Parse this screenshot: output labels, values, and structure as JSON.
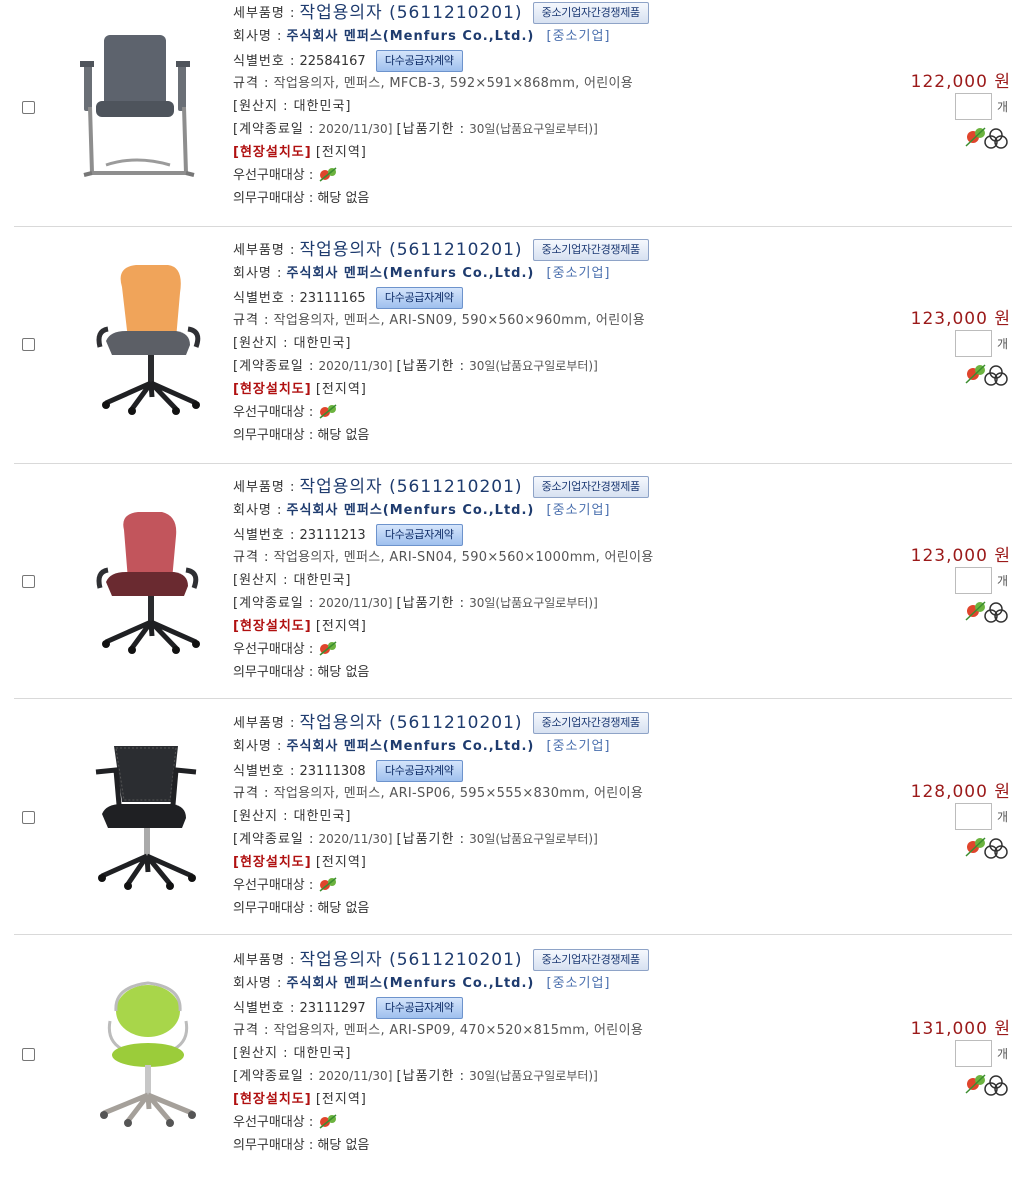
{
  "labels": {
    "detail_name": "세부품명 :",
    "company": "회사명 :",
    "id": "식별번호 :",
    "spec": "규격 :",
    "origin": "[원산지 : 대한민국]",
    "contract_end": "[계약종료일 :",
    "delivery": "[납품기한 :",
    "install": "[현장설치도]",
    "region": "[전지역]",
    "priority": "우선구매대상 :",
    "mandatory": "의무구매대상 :",
    "mandatory_value": "해당 없음",
    "unit": "개",
    "currency": "원"
  },
  "items": [
    {
      "name": "작업용의자 (5611210201)",
      "badge_competition": "중소기업자간경쟁제품",
      "company": "주식회사 멘퍼스(Menfurs Co.,Ltd.)",
      "company_type": "[중소기업]",
      "id": "22584167",
      "badge_contract": "다수공급자계약",
      "spec": "작업용의자, 멘퍼스, MFCB-3, 592×591×868mm, 어린이용",
      "contract_end": "2020/11/30]",
      "delivery": "30일(납품요구일로부터)]",
      "price": "122,000",
      "qty": "",
      "image": "chair-gray-cantilever"
    },
    {
      "name": "작업용의자 (5611210201)",
      "badge_competition": "중소기업자간경쟁제품",
      "company": "주식회사 멘퍼스(Menfurs Co.,Ltd.)",
      "company_type": "[중소기업]",
      "id": "23111165",
      "badge_contract": "다수공급자계약",
      "spec": "작업용의자, 멘퍼스, ARI-SN09, 590×560×960mm, 어린이용",
      "contract_end": "2020/11/30]",
      "delivery": "30일(납품요구일로부터)]",
      "price": "123,000",
      "qty": "",
      "image": "chair-orange-swivel"
    },
    {
      "name": "작업용의자 (5611210201)",
      "badge_competition": "중소기업자간경쟁제품",
      "company": "주식회사 멘퍼스(Menfurs Co.,Ltd.)",
      "company_type": "[중소기업]",
      "id": "23111213",
      "badge_contract": "다수공급자계약",
      "spec": "작업용의자, 멘퍼스, ARI-SN04, 590×560×1000mm, 어린이용",
      "contract_end": "2020/11/30]",
      "delivery": "30일(납품요구일로부터)]",
      "price": "123,000",
      "qty": "",
      "image": "chair-red-swivel"
    },
    {
      "name": "작업용의자 (5611210201)",
      "badge_competition": "중소기업자간경쟁제품",
      "company": "주식회사 멘퍼스(Menfurs Co.,Ltd.)",
      "company_type": "[중소기업]",
      "id": "23111308",
      "badge_contract": "다수공급자계약",
      "spec": "작업용의자, 멘퍼스, ARI-SP06, 595×555×830mm, 어린이용",
      "contract_end": "2020/11/30]",
      "delivery": "30일(납품요구일로부터)]",
      "price": "128,000",
      "qty": "",
      "image": "chair-black-mesh"
    },
    {
      "name": "작업용의자 (5611210201)",
      "badge_competition": "중소기업자간경쟁제품",
      "company": "주식회사 멘퍼스(Menfurs Co.,Ltd.)",
      "company_type": "[중소기업]",
      "id": "23111297",
      "badge_contract": "다수공급자계약",
      "spec": "작업용의자, 멘퍼스, ARI-SP09, 470×520×815mm, 어린이용",
      "contract_end": "2020/11/30]",
      "delivery": "30일(납품요구일로부터)]",
      "price": "131,000",
      "qty": "",
      "image": "chair-green-round"
    }
  ]
}
